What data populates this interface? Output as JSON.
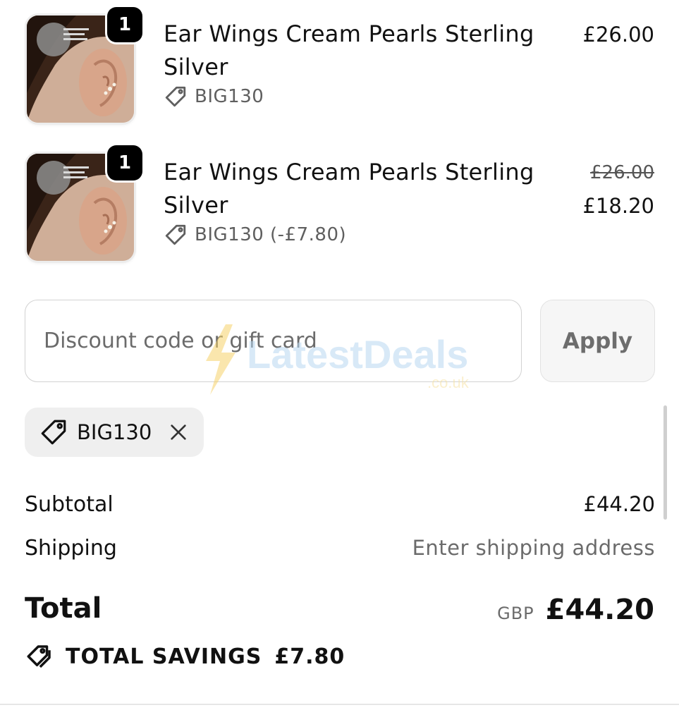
{
  "items": [
    {
      "quantity": "1",
      "title_line1": "Ear Wings Cream Pearls Sterling",
      "title_line2": "Silver",
      "discount_tag": "BIG130",
      "price": "£26.00"
    },
    {
      "quantity": "1",
      "title_line1": "Ear Wings Cream Pearls Sterling",
      "title_line2": "Silver",
      "discount_tag": "BIG130 (-£7.80)",
      "original_price": "£26.00",
      "price": "£18.20"
    }
  ],
  "discount": {
    "placeholder": "Discount code or gift card",
    "apply_label": "Apply",
    "applied_code": "BIG130"
  },
  "summary": {
    "subtotal_label": "Subtotal",
    "subtotal_value": "£44.20",
    "shipping_label": "Shipping",
    "shipping_value": "Enter shipping address",
    "total_label": "Total",
    "currency": "GBP",
    "total_value": "£44.20",
    "savings_label": "TOTAL SAVINGS",
    "savings_value": "£7.80"
  },
  "watermark": {
    "brand": "LatestDeals",
    "domain": ".co.uk"
  },
  "icons": [
    "tag-icon",
    "close-icon",
    "tags-icon"
  ],
  "colors": {
    "text": "#111111",
    "muted": "#6b6b6b",
    "chip_bg": "#efefef",
    "badge": "#000000"
  }
}
